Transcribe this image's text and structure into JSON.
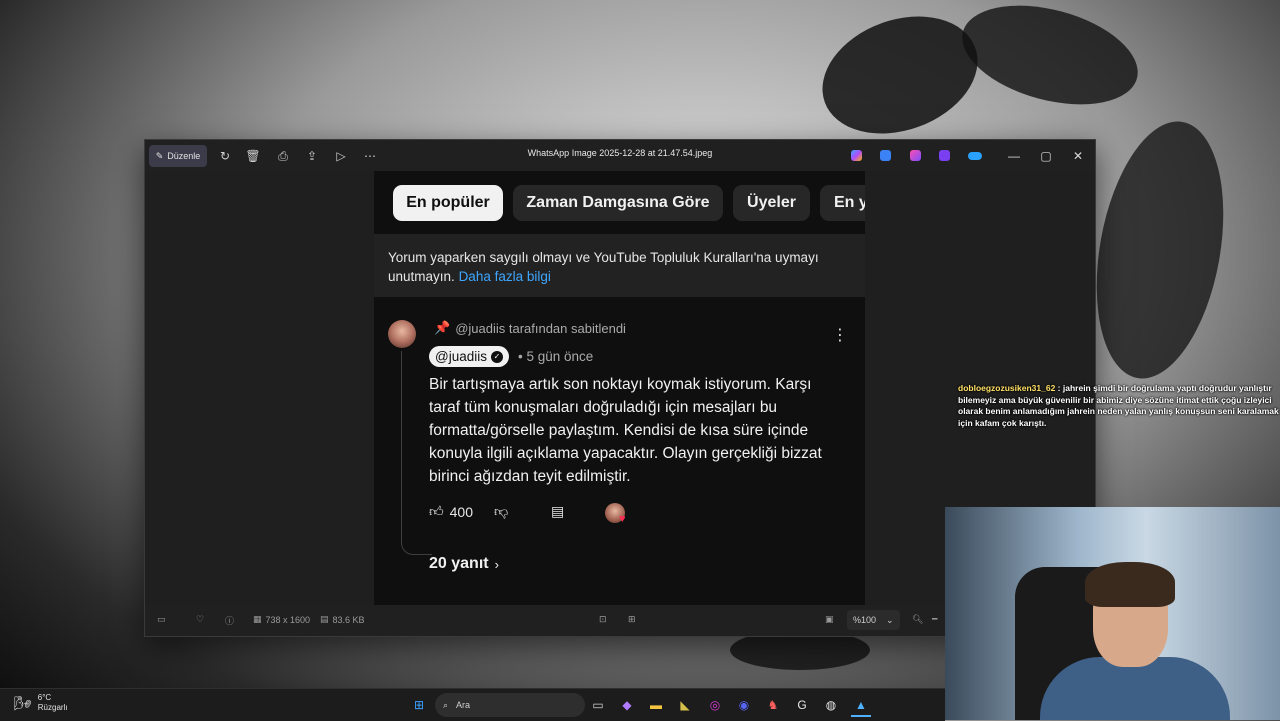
{
  "window": {
    "title": "WhatsApp Image 2025-12-28 at 21.47.54.jpeg",
    "edit_label": "Düzenle",
    "status": {
      "dimensions": "738 x 1600",
      "file_size": "83.6 KB",
      "zoom": "%100"
    }
  },
  "photo": {
    "chips": [
      "En popüler",
      "Zaman Damgasına Göre",
      "Üyeler",
      "En y"
    ],
    "notice_text": "Yorum yaparken saygılı olmayı ve YouTube Topluluk Kuralları'na uymayı unutmayın.",
    "notice_link": "Daha fazla bilgi",
    "pinned_by": "@juadiis tarafından sabitlendi",
    "author": "@juadiis",
    "time_ago": "5 gün önce",
    "comment": "Bir tartışmaya artık son noktayı koymak istiyorum. Karşı taraf tüm konuşmaları doğruladığı için mesajları bu formatta/görselle paylaştım. Kendisi de kısa süre içinde konuyla ilgili açıklama yapacaktır. Olayın gerçekliği bizzat birinci ağızdan teyit edilmiştir.",
    "likes": "400",
    "replies": "20 yanıt"
  },
  "chat": {
    "user": "dobloegzozusiken31_62",
    "message": "jahrein şimdi bir doğrulama yaptı doğrudur yanlıştır bilemeyiz ama büyük güvenilir bir abimiz diye sözüne itimat ettik çoğu izleyici olarak benim anlamadığım jahrein neden yalan yanlış konuşsun seni karalamak için kafam çok karıştı."
  },
  "taskbar": {
    "temperature": "6°C",
    "weather": "Rüzgarlı",
    "search_placeholder": "Ara"
  },
  "colors": {
    "youtube_link": "#3ea6ff",
    "chat_username": "#ffe066",
    "window_bg": "#1f1f1f"
  }
}
